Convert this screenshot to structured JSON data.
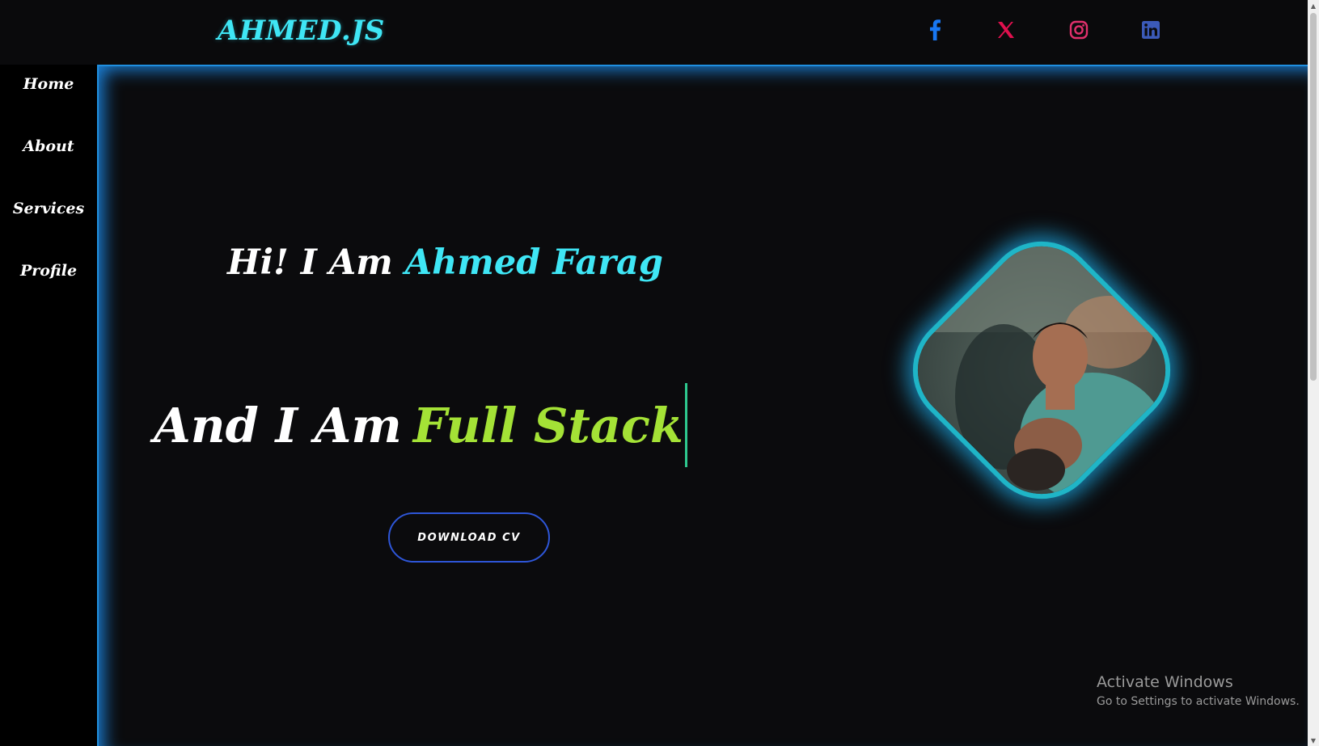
{
  "header": {
    "logo": "AHMED.JS"
  },
  "social": [
    {
      "name": "facebook-icon",
      "color": "#1877f2"
    },
    {
      "name": "x-icon",
      "color": "#e0104e"
    },
    {
      "name": "instagram-icon",
      "color": "#e1306c"
    },
    {
      "name": "linkedin-icon",
      "color": "#3b5ab8"
    }
  ],
  "sidebar": {
    "items": [
      {
        "label": "Home"
      },
      {
        "label": "About"
      },
      {
        "label": "Services"
      },
      {
        "label": "Profile"
      }
    ]
  },
  "hero": {
    "greeting": "Hi! I Am",
    "name": "Ahmed Farag",
    "role_prefix": "And I Am",
    "role": "Full Stack",
    "cv_button": "DOWNLOAD CV"
  },
  "watermark": {
    "title": "Activate Windows",
    "subtitle": "Go to Settings to activate Windows."
  },
  "colors": {
    "accent_cyan": "#3fe6f5",
    "accent_green": "#a4e236",
    "glow_blue": "#1f8fe0",
    "button_border": "#2e56d8"
  }
}
